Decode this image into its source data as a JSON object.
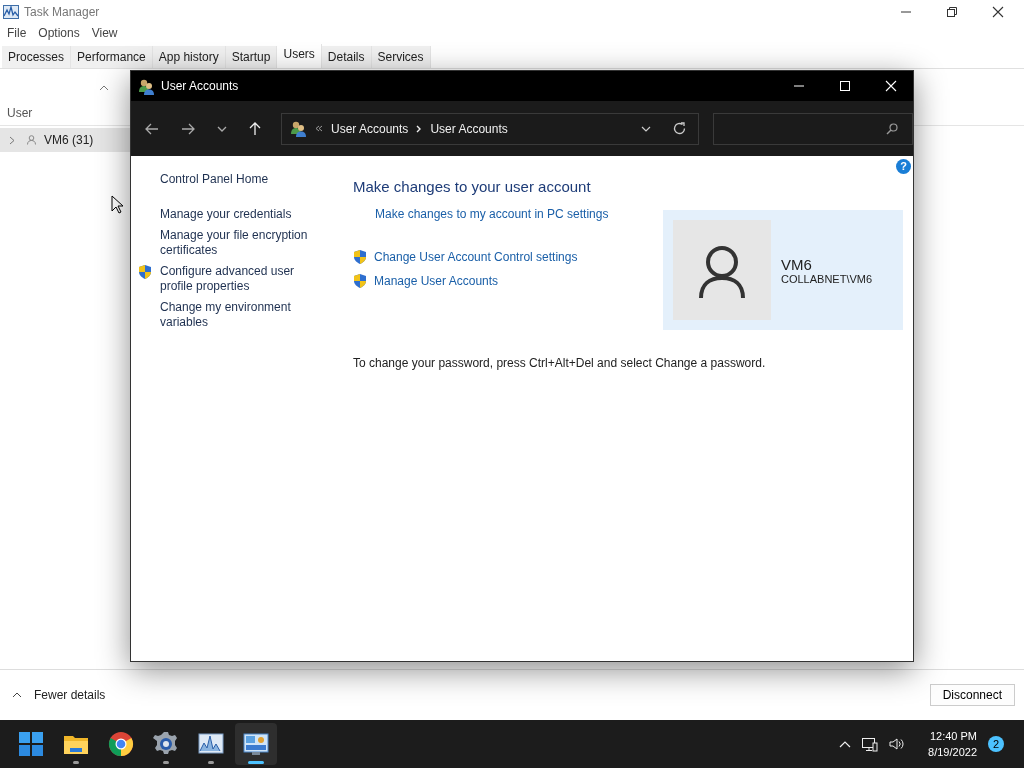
{
  "task_manager": {
    "title": "Task Manager",
    "menu": [
      "File",
      "Options",
      "View"
    ],
    "tabs": [
      {
        "label": "Processes",
        "selected": false
      },
      {
        "label": "Performance",
        "selected": false
      },
      {
        "label": "App history",
        "selected": false
      },
      {
        "label": "Startup",
        "selected": false
      },
      {
        "label": "Users",
        "selected": true
      },
      {
        "label": "Details",
        "selected": false
      },
      {
        "label": "Services",
        "selected": false
      }
    ],
    "column_header": "User",
    "rows": [
      {
        "name": "VM6 (31)",
        "expanded": false
      }
    ],
    "footer_toggle": "Fewer details",
    "footer_button": "Disconnect"
  },
  "user_accounts": {
    "title": "User Accounts",
    "breadcrumb": [
      "User Accounts",
      "User Accounts"
    ],
    "help": "?",
    "sidebar": [
      {
        "label": "Control Panel Home",
        "shield": false
      },
      {
        "label": "Manage your credentials",
        "shield": false
      },
      {
        "label": "Manage your file encryption certificates",
        "shield": false
      },
      {
        "label": "Configure advanced user profile properties",
        "shield": true
      },
      {
        "label": "Change my environment variables",
        "shield": false
      }
    ],
    "heading": "Make changes to your user account",
    "tasks": [
      {
        "label": "Make changes to my account in PC settings",
        "shield": false
      },
      {
        "label": "Change User Account Control settings",
        "shield": true
      },
      {
        "label": "Manage User Accounts",
        "shield": true
      }
    ],
    "account": {
      "name": "VM6",
      "domain": "COLLABNET\\VM6"
    },
    "note": "To change your password, press Ctrl+Alt+Del and select Change a password."
  },
  "taskbar": {
    "apps": [
      {
        "kind": "start",
        "running": false,
        "selected": false
      },
      {
        "kind": "folder",
        "running": true,
        "selected": false
      },
      {
        "kind": "browser",
        "running": false,
        "selected": false
      },
      {
        "kind": "gear",
        "running": true,
        "selected": false
      },
      {
        "kind": "monitor",
        "running": true,
        "selected": false
      },
      {
        "kind": "panel",
        "running": true,
        "selected": true
      }
    ],
    "time": "12:40 PM",
    "date": "8/19/2022",
    "notification_count": "2"
  }
}
